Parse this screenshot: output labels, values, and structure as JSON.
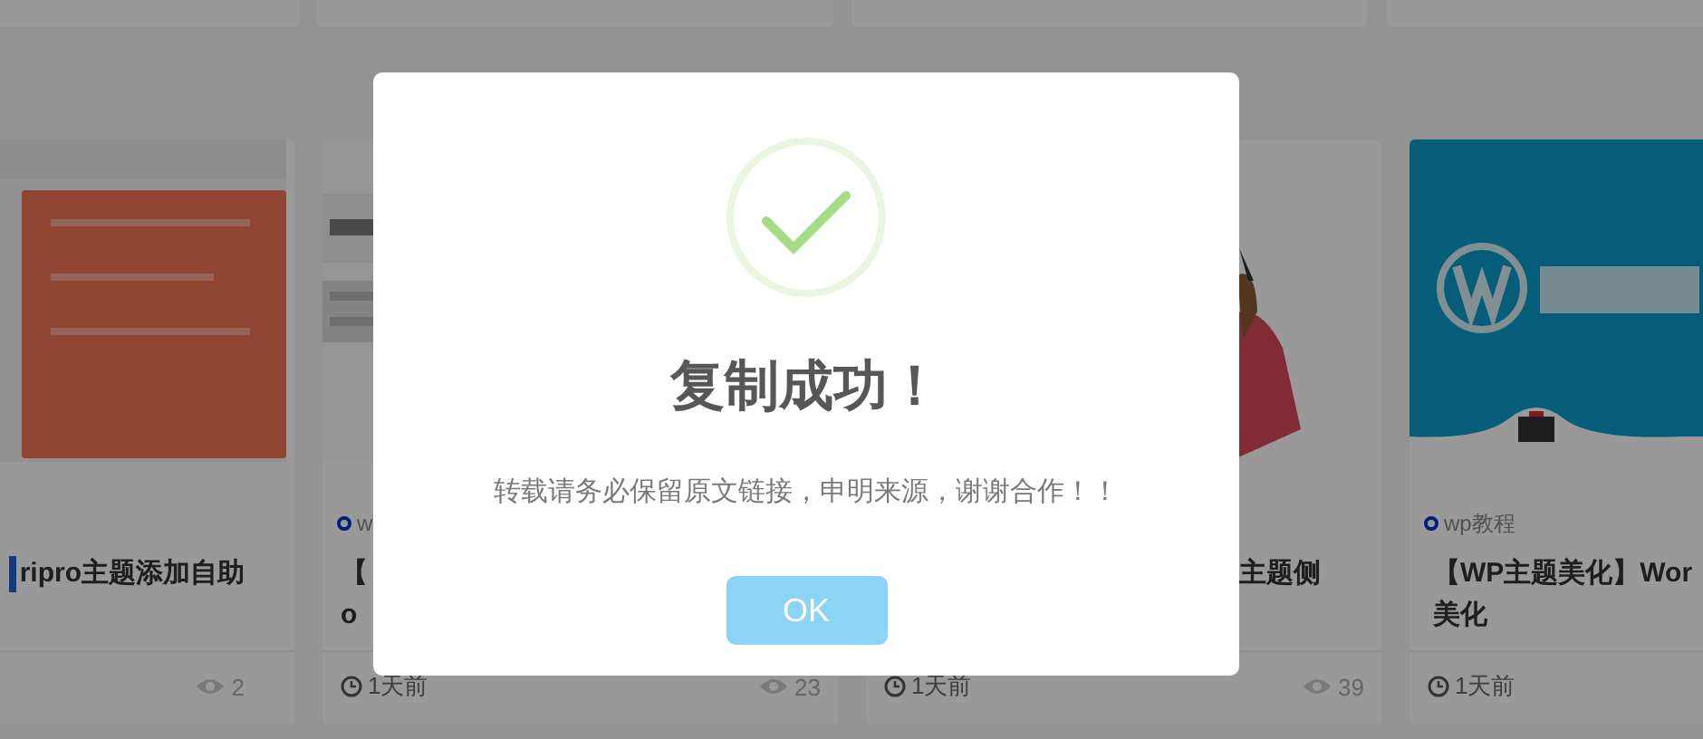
{
  "cards": [
    {
      "marker": true,
      "title_lines": [
        "ripro主题添加自助"
      ],
      "views": "2"
    },
    {
      "marker": false,
      "category": "w",
      "title_lines": [
        "【",
        "o"
      ],
      "time": "1天前",
      "views": "23"
    },
    {
      "marker": false,
      "title_lines": [
        "主题侧"
      ],
      "time": "1天前",
      "views": "39"
    },
    {
      "marker": false,
      "category": "wp教程",
      "title_lines": [
        "【WP主题美化】Wor",
        "美化"
      ],
      "time": "1天前"
    }
  ],
  "dialog": {
    "title": "复制成功！",
    "message": "转载请务必保留原文链接，申明来源，谢谢合作！！",
    "button": "OK"
  }
}
